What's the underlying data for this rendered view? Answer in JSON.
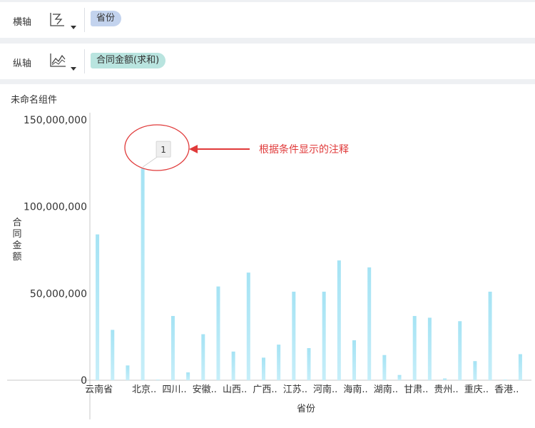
{
  "shelves": {
    "x": {
      "label": "横轴",
      "field": "省份"
    },
    "y": {
      "label": "纵轴",
      "field": "合同金额(求和)"
    }
  },
  "icons": {
    "x_chart_type": "bar-chart-type-icon",
    "y_chart_type": "line-chart-type-icon",
    "dropdown": "caret-down-icon"
  },
  "component": {
    "title": "未命名组件"
  },
  "annotation": {
    "marker_label": "1",
    "callout_text": "根据条件显示的注释",
    "target_category_index": 3,
    "color": "#e03a3a"
  },
  "colors": {
    "bar": "#aee6f5",
    "bar_gradient_top": "#a5e3f4",
    "bar_gradient_bottom": "#c6eef9",
    "axis": "#c8c8c8"
  },
  "chart_data": {
    "type": "bar",
    "title": "",
    "xlabel": "省份",
    "ylabel": "合同金额",
    "ylim": [
      0,
      150000000
    ],
    "yticks": [
      0,
      50000000,
      100000000,
      150000000
    ],
    "ytick_labels": [
      "0",
      "50,000,000",
      "100,000,000",
      "150,000,000"
    ],
    "grid": false,
    "categories": [
      "云南省",
      "",
      "",
      "北京..",
      "",
      "四川..",
      "",
      "安徽..",
      "",
      "山西..",
      "",
      "广西..",
      "",
      "江苏..",
      "",
      "河南..",
      "",
      "海南..",
      "",
      "湖南..",
      "",
      "甘肃..",
      "",
      "贵州..",
      "",
      "重庆..",
      "",
      "香港..",
      ""
    ],
    "values": [
      84000000,
      29000000,
      8500000,
      122000000,
      0,
      37000000,
      4500000,
      26500000,
      54000000,
      16500000,
      62000000,
      13000000,
      20500000,
      51000000,
      18500000,
      51000000,
      69000000,
      23000000,
      65000000,
      14500000,
      3000000,
      37000000,
      36000000,
      1000000,
      34000000,
      11000000,
      51000000,
      0,
      15000000
    ]
  }
}
